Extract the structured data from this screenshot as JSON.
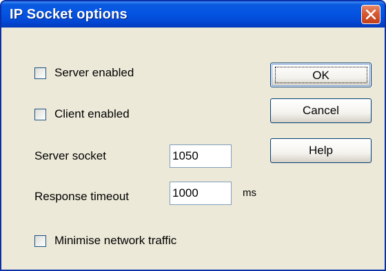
{
  "window": {
    "title": "IP Socket options"
  },
  "checkboxes": {
    "server_enabled": {
      "label": "Server enabled",
      "checked": false
    },
    "client_enabled": {
      "label": "Client enabled",
      "checked": false
    },
    "minimise_traffic": {
      "label": "Minimise network traffic",
      "checked": false
    }
  },
  "fields": {
    "server_socket": {
      "label": "Server socket",
      "value": "1050"
    },
    "response_timeout": {
      "label": "Response timeout",
      "value": "1000",
      "unit": "ms"
    }
  },
  "buttons": {
    "ok": "OK",
    "cancel": "Cancel",
    "help": "Help"
  },
  "colors": {
    "titlebar": "#0554e3",
    "close_button": "#d65a32",
    "dialog_background": "#ece9d8"
  }
}
